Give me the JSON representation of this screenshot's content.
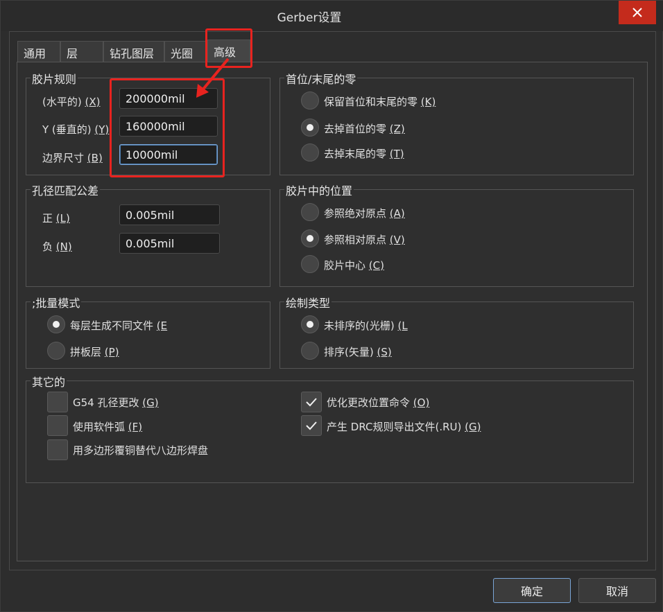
{
  "window": {
    "title": "Gerber设置"
  },
  "tabs": [
    {
      "label": "通用"
    },
    {
      "label": "层"
    },
    {
      "label": "钻孔图层"
    },
    {
      "label": "光圈"
    },
    {
      "label": "高级"
    }
  ],
  "film_rules": {
    "title": "胶片规则",
    "horizontal": {
      "label": "(水平的)",
      "key": "(X)",
      "value": "200000mil"
    },
    "vertical": {
      "label": "Y (垂直的)",
      "key": "(Y)",
      "value": "160000mil"
    },
    "border": {
      "label": "边界尺寸",
      "key": "(B)",
      "value": "10000mil"
    }
  },
  "leading_trailing_zeros": {
    "title": "首位/末尾的零",
    "options": [
      {
        "label": "保留首位和末尾的零",
        "key": "(K)",
        "checked": false
      },
      {
        "label": "去掉首位的零",
        "key": "(Z)",
        "checked": true
      },
      {
        "label": "去掉末尾的零",
        "key": "(T)",
        "checked": false
      }
    ]
  },
  "hole_tolerance": {
    "title": "孔径匹配公差",
    "plus": {
      "label": "正",
      "key": "(L)",
      "value": "0.005mil"
    },
    "minus": {
      "label": "负",
      "key": "(N)",
      "value": "0.005mil"
    }
  },
  "film_position": {
    "title": "胶片中的位置",
    "options": [
      {
        "label": "参照绝对原点",
        "key": "(A)",
        "checked": false
      },
      {
        "label": "参照相对原点",
        "key": "(V)",
        "checked": true
      },
      {
        "label": "胶片中心",
        "key": "(C)",
        "checked": false
      }
    ]
  },
  "batch_mode": {
    "title": ";批量模式",
    "options": [
      {
        "label": "每层生成不同文件",
        "key": "(E",
        "checked": true
      },
      {
        "label": "拼板层",
        "key": "(P)",
        "checked": false
      }
    ]
  },
  "plot_type": {
    "title": "绘制类型",
    "options": [
      {
        "label": "未排序的(光栅)",
        "key": "(L",
        "checked": true
      },
      {
        "label": "排序(矢量)",
        "key": "(S)",
        "checked": false
      }
    ]
  },
  "other": {
    "title": "其它的",
    "items": [
      {
        "label": "G54 孔径更改",
        "key": "(G)",
        "checked": false
      },
      {
        "label": "使用软件弧",
        "key": "(F)",
        "checked": false
      },
      {
        "label": "用多边形覆铜替代八边形焊盘",
        "key": "",
        "checked": false
      },
      {
        "label": "优化更改位置命令",
        "key": "(O)",
        "checked": true
      },
      {
        "label": "产生 DRC规则导出文件(.RU)",
        "key": "(G)",
        "checked": true
      }
    ]
  },
  "buttons": {
    "ok": "确定",
    "cancel": "取消"
  },
  "colors": {
    "highlight": "#e8231f",
    "accent": "#7aa6d8",
    "close": "#c42b1c"
  }
}
